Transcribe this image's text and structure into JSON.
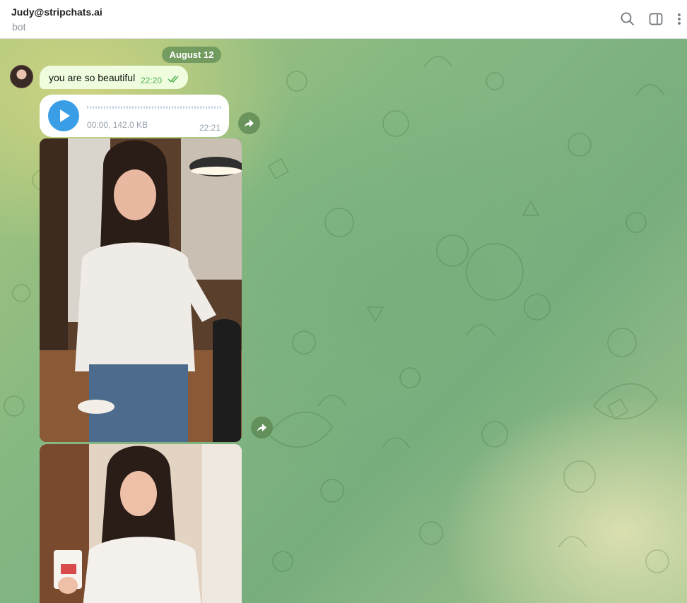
{
  "header": {
    "title": "Judy@stripchats.ai",
    "status": "bot",
    "icons": [
      "search-icon",
      "sidebar-toggle-icon",
      "more-vertical-icon"
    ]
  },
  "chat": {
    "date_separator": "August 12",
    "messages": [
      {
        "type": "text",
        "text": "you are so beautiful",
        "time": "22:20",
        "read": true
      },
      {
        "type": "voice",
        "duration_size": "00:00, 142.0 KB",
        "time": "22:21"
      },
      {
        "type": "photo",
        "description_icon": "photo"
      },
      {
        "type": "photo",
        "description_icon": "photo"
      }
    ]
  },
  "colors": {
    "outgoing_bubble": "#effdde",
    "play_button": "#3a9ee6",
    "time_outgoing": "#4fae4e"
  }
}
